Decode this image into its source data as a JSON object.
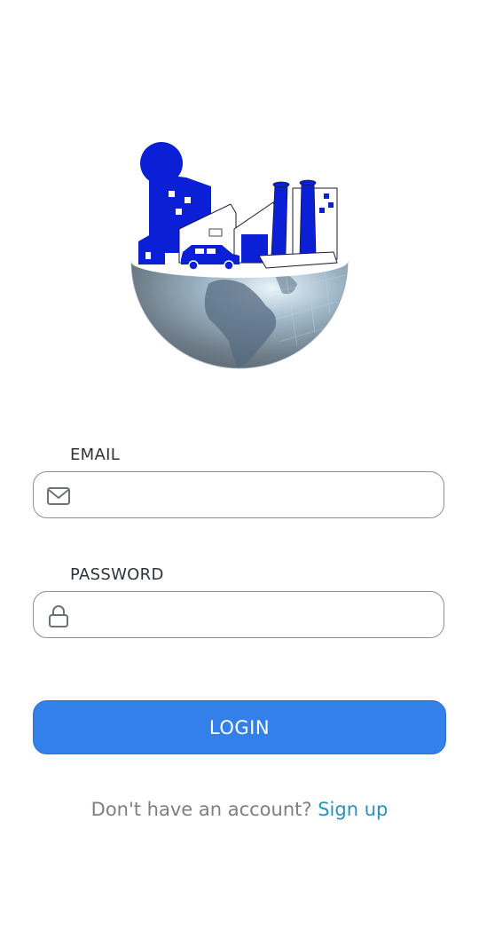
{
  "logo": {
    "icon": "city-globe-icon"
  },
  "email": {
    "label": "EMAIL",
    "value": "",
    "placeholder": "",
    "icon": "mail-icon"
  },
  "password": {
    "label": "PASSWORD",
    "value": "",
    "placeholder": "",
    "icon": "lock-icon"
  },
  "login_button": {
    "label": "LOGIN"
  },
  "signup": {
    "prompt": "Don't have an account?",
    "link_label": "Sign up"
  },
  "colors": {
    "primary": "#3380ea",
    "link": "#2f8fb8",
    "logo_blue": "#0a1fd6",
    "globe": "#6f7b86"
  }
}
